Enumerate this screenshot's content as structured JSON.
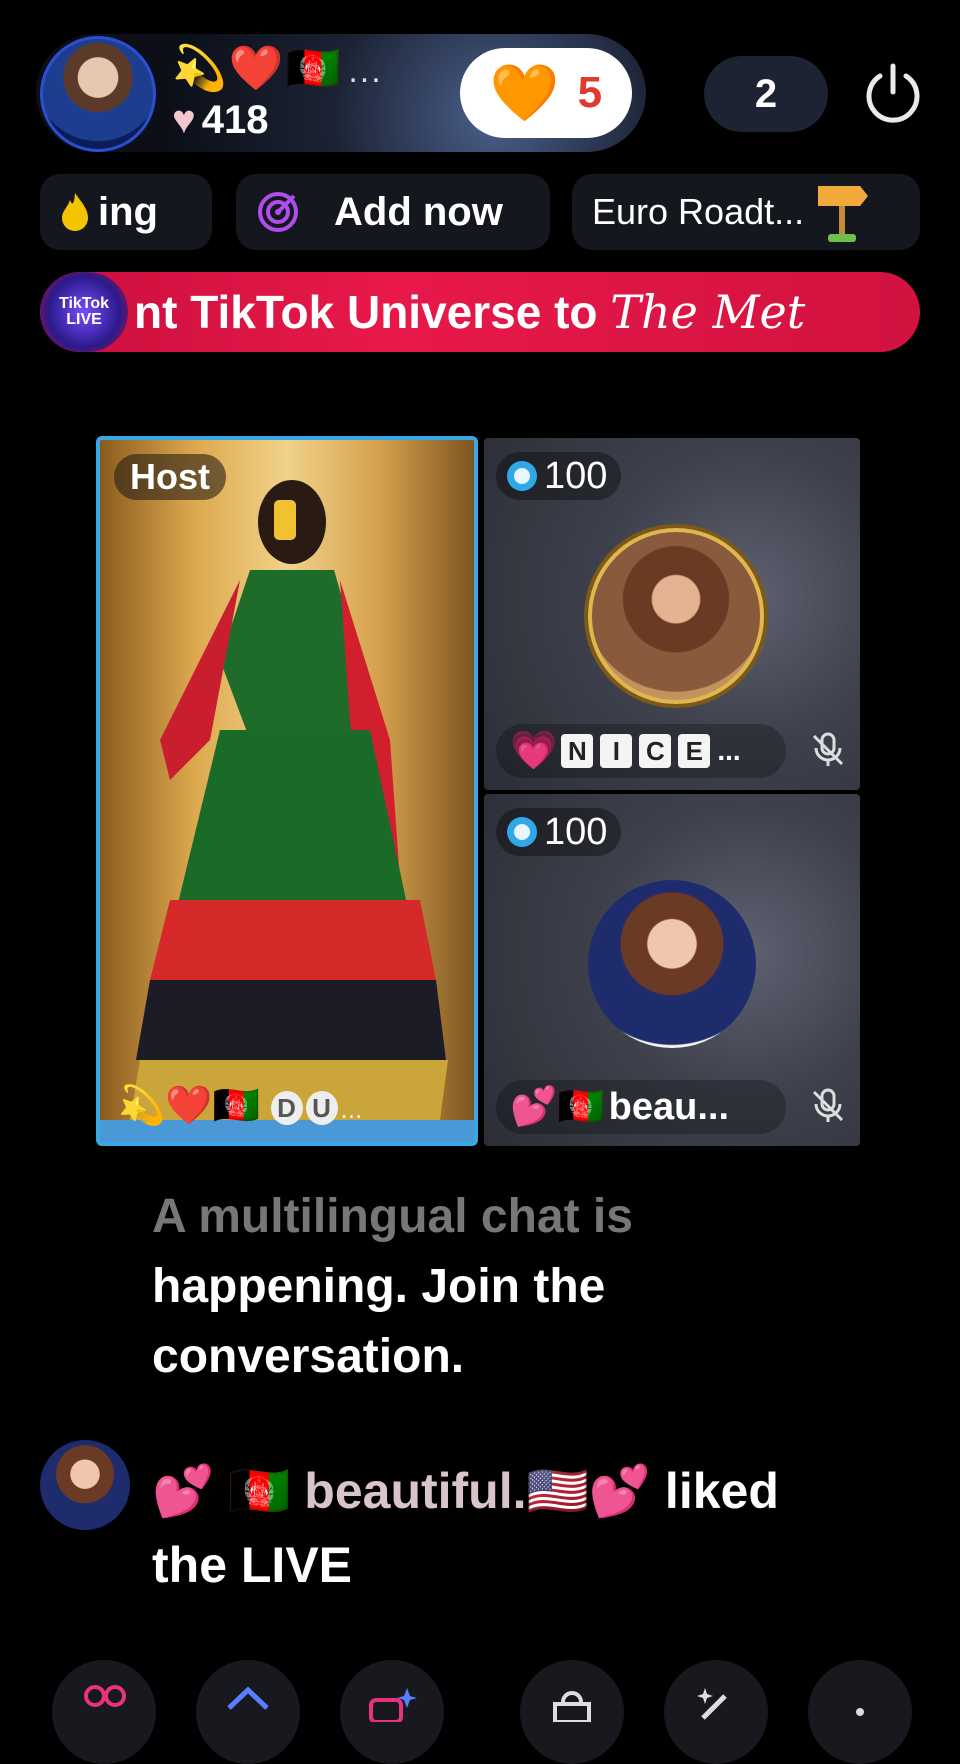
{
  "host": {
    "badges": "💫❤️🇦🇫",
    "badges_more": "...",
    "likes_icon": "♥",
    "likes": "418"
  },
  "gift": {
    "icon": "🧡",
    "count": "5"
  },
  "viewers": {
    "count": "2"
  },
  "chips": {
    "ranking_label": "ing",
    "add_label": "Add now",
    "euro_label": "Euro Roadt..."
  },
  "banner": {
    "logo_text": "TikTok LIVE",
    "text_main": "nt TikTok Universe to ",
    "text_script": "The Met"
  },
  "grid": {
    "host_tag": "Host",
    "host_caption_emoji": "💫❤️🇦🇫",
    "host_caption_letters": [
      "D",
      "U"
    ],
    "host_caption_more": "...",
    "guests": [
      {
        "score": "100",
        "name_emoji": "💗",
        "name_letters": [
          "N",
          "I",
          "C",
          "E"
        ],
        "name_more": "..."
      },
      {
        "score": "100",
        "name_emoji": "💕🇦🇫",
        "name": "beau..."
      }
    ]
  },
  "chat": {
    "system_line1": "A multilingual chat is",
    "system_line2": "happening. Join the",
    "system_line3": "conversation.",
    "join_user_prefix": "💕 🇦🇫 beautiful.🇺🇸💕",
    "join_action": " liked",
    "join_line2": "the LIVE"
  },
  "colors": {
    "banner": "#e8194a",
    "host_border": "#3aa7e6",
    "gift_count": "#e03a2f"
  }
}
